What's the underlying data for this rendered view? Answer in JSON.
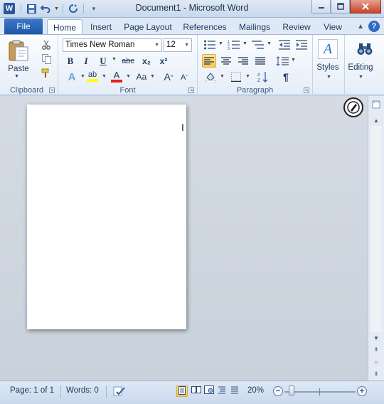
{
  "window": {
    "title": "Document1  -  Microsoft Word",
    "app_icon": "W"
  },
  "qat": {
    "save": "save-icon",
    "undo": "undo-icon",
    "redo": "redo-icon",
    "customize": "customize-qat-icon"
  },
  "tabs": {
    "file": "File",
    "items": [
      "Home",
      "Insert",
      "Page Layout",
      "References",
      "Mailings",
      "Review",
      "View"
    ],
    "active": "Home"
  },
  "ribbon": {
    "clipboard": {
      "label": "Clipboard",
      "paste": "Paste"
    },
    "font": {
      "label": "Font",
      "family": "Times New Roman",
      "size": "12",
      "bold": "B",
      "italic": "I",
      "underline": "U",
      "strike": "abc",
      "subscript": "x₂",
      "superscript": "x²",
      "grow": "A",
      "shrink": "A",
      "change_case": "Aa",
      "highlight_text": "ab",
      "font_color_text": "A",
      "text_effects_text": "A"
    },
    "paragraph": {
      "label": "Paragraph",
      "pilcrow": "¶"
    },
    "styles": {
      "label": "Styles",
      "glyph": "A"
    },
    "editing": {
      "label": "Editing"
    }
  },
  "statusbar": {
    "page": "Page: 1 of 1",
    "words": "Words: 0",
    "zoom": "20%",
    "zoom_level": 0.2
  },
  "colors": {
    "file_tab": "#1f57a8",
    "highlight": "#ffff00",
    "font_color": "#e02020",
    "active_button": "#f9c85a"
  }
}
